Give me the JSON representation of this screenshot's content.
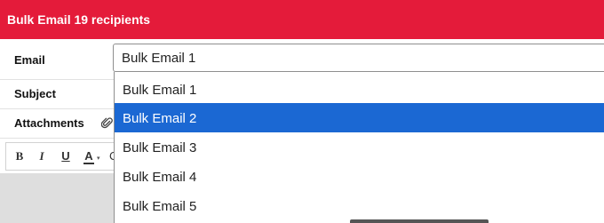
{
  "header": {
    "title": "Bulk Email 19 recipients",
    "bg_color": "#e41b3a"
  },
  "form": {
    "email_label": "Email",
    "subject_label": "Subject",
    "attachments_label": "Attachments",
    "email_value": "Bulk Email 1"
  },
  "toolbar": {
    "bold": "B",
    "italic": "I",
    "underline": "U",
    "font_color": "A",
    "more": "C"
  },
  "dropdown": {
    "options": [
      "Bulk Email 1",
      "Bulk Email 2",
      "Bulk Email 3",
      "Bulk Email 4",
      "Bulk Email 5"
    ],
    "selected_index": 1,
    "selected_color": "#1b68d3"
  },
  "icons": {
    "attachment": "paperclip-icon"
  }
}
